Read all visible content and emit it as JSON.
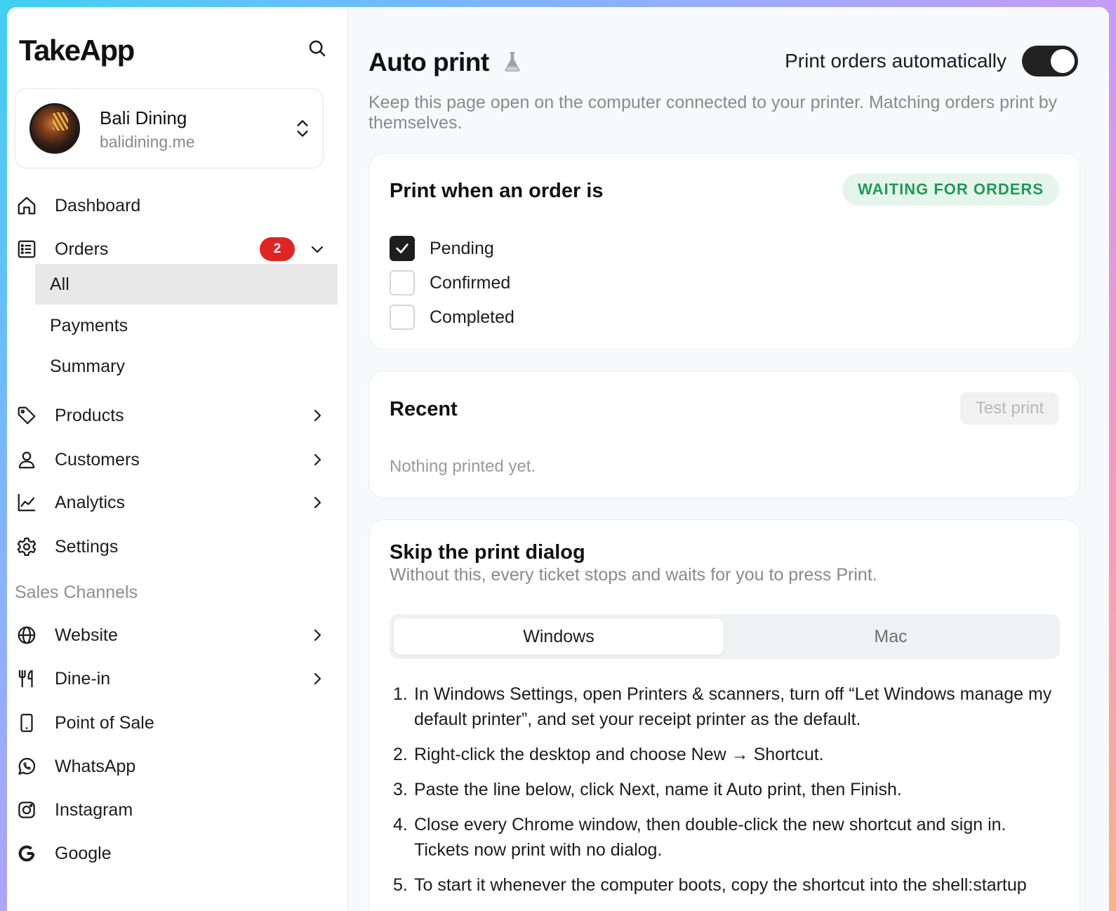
{
  "brand": {
    "logo": "TakeApp"
  },
  "store": {
    "name": "Bali Dining",
    "domain": "balidining.me"
  },
  "nav": {
    "dashboard": "Dashboard",
    "orders": "Orders",
    "orders_badge": "2",
    "orders_sub": [
      "All",
      "Payments",
      "Summary"
    ],
    "products": "Products",
    "customers": "Customers",
    "analytics": "Analytics",
    "settings": "Settings"
  },
  "sales_channels": {
    "label": "Sales Channels",
    "website": "Website",
    "dine_in": "Dine-in",
    "pos": "Point of Sale",
    "whatsapp": "WhatsApp",
    "instagram": "Instagram",
    "google": "Google"
  },
  "header": {
    "title": "Auto print",
    "toggle_label": "Print orders automatically",
    "toggle_on": true,
    "subtitle": "Keep this page open on the computer connected to your printer. Matching orders print by themselves."
  },
  "print_when": {
    "title": "Print when an order is",
    "status": "WAITING FOR ORDERS",
    "options": [
      {
        "label": "Pending",
        "checked": true
      },
      {
        "label": "Confirmed",
        "checked": false
      },
      {
        "label": "Completed",
        "checked": false
      }
    ]
  },
  "recent": {
    "title": "Recent",
    "test_print": "Test print",
    "empty": "Nothing printed yet."
  },
  "skip_dialog": {
    "title": "Skip the print dialog",
    "subtitle": "Without this, every ticket stops and waits for you to press Print.",
    "tabs": [
      "Windows",
      "Mac"
    ],
    "active_tab": "Windows",
    "steps": [
      "In Windows Settings, open Printers & scanners, turn off “Let Windows manage my default printer”, and set your receipt printer as the default.",
      "Right-click the desktop and choose New → Shortcut.",
      "Paste the line below, click Next, name it Auto print, then Finish.",
      "Close every Chrome window, then double-click the new shortcut and sign in. Tickets now print with no dialog.",
      "To start it whenever the computer boots, copy the shortcut into the shell:startup"
    ]
  },
  "colors": {
    "badge": "#e02424",
    "status_bg": "#e6f5ec",
    "status_text": "#1f9a57",
    "toggle": "#222222"
  }
}
